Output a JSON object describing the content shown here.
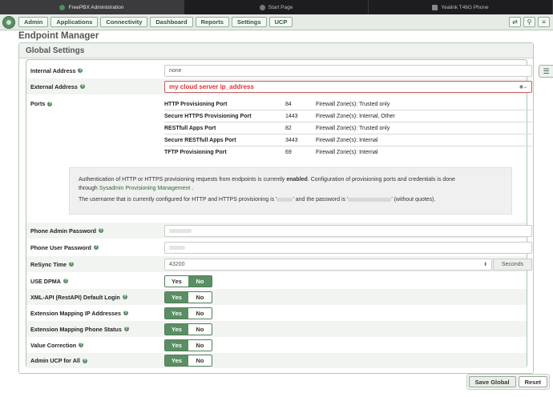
{
  "browser": {
    "tabs": [
      {
        "title": "FreePBX Administration",
        "active": true
      },
      {
        "title": "Start Page",
        "active": false
      },
      {
        "title": "Yealink T46G Phone",
        "active": false
      }
    ]
  },
  "nav": {
    "items": [
      "Admin",
      "Applications",
      "Connectivity",
      "Dashboard",
      "Reports",
      "Settings",
      "UCP"
    ],
    "right_icons": [
      "transfer-icon",
      "search-icon",
      "menu-icon"
    ]
  },
  "page": {
    "title": "Endpoint Manager",
    "section_title": "Global Settings"
  },
  "fields": {
    "internal_address": {
      "label": "Internal Address",
      "value": "none"
    },
    "external_address": {
      "label": "External Address",
      "value": "my cloud server ip_address"
    },
    "ports_label": "Ports",
    "phone_admin_password": {
      "label": "Phone Admin Password"
    },
    "phone_user_password": {
      "label": "Phone User Password"
    },
    "resync_time": {
      "label": "ReSync Time",
      "value": "43200",
      "unit": "Seconds"
    }
  },
  "ports": [
    {
      "name": "HTTP Provisioning Port",
      "value": "84",
      "zones": "Firewall Zone(s): Trusted only"
    },
    {
      "name": "Secure HTTPS Provisioning Port",
      "value": "1443",
      "zones": "Firewall Zone(s): Internal, Other"
    },
    {
      "name": "RESTfull Apps Port",
      "value": "82",
      "zones": "Firewall Zone(s): Trusted only"
    },
    {
      "name": "Secure RESTfull Apps Port",
      "value": "3443",
      "zones": "Firewall Zone(s): Internal"
    },
    {
      "name": "TFTP Provisioning Port",
      "value": "69",
      "zones": "Firewall Zone(s): Internal"
    }
  ],
  "info": {
    "line1_a": "Authentication of HTTP or HTTPS provisioning requests from endpoints is currently ",
    "line1_bold": "enabled",
    "line1_b": ". Configuration of provisioning ports and credentials is done",
    "line2_a": "through ",
    "line2_link": "Sysadmin Provisioning Management",
    "line2_b": " .",
    "line3_a": "The username that is currently configured for HTTP and HTTPS provisioning is '",
    "line3_b": "' and the password is '",
    "line3_c": "' (without quotes)."
  },
  "toggles": [
    {
      "label": "USE DPMA",
      "selected": "No"
    },
    {
      "label": "XML-API (RestAPI) Default Login",
      "selected": "Yes"
    },
    {
      "label": "Extension Mapping IP Addresses",
      "selected": "Yes"
    },
    {
      "label": "Extension Mapping Phone Status",
      "selected": "Yes"
    },
    {
      "label": "Value Correction",
      "selected": "Yes"
    },
    {
      "label": "Admin UCP for All",
      "selected": "Yes"
    }
  ],
  "yes_label": "Yes",
  "no_label": "No",
  "footer": {
    "save": "Save Global",
    "reset": "Reset"
  }
}
